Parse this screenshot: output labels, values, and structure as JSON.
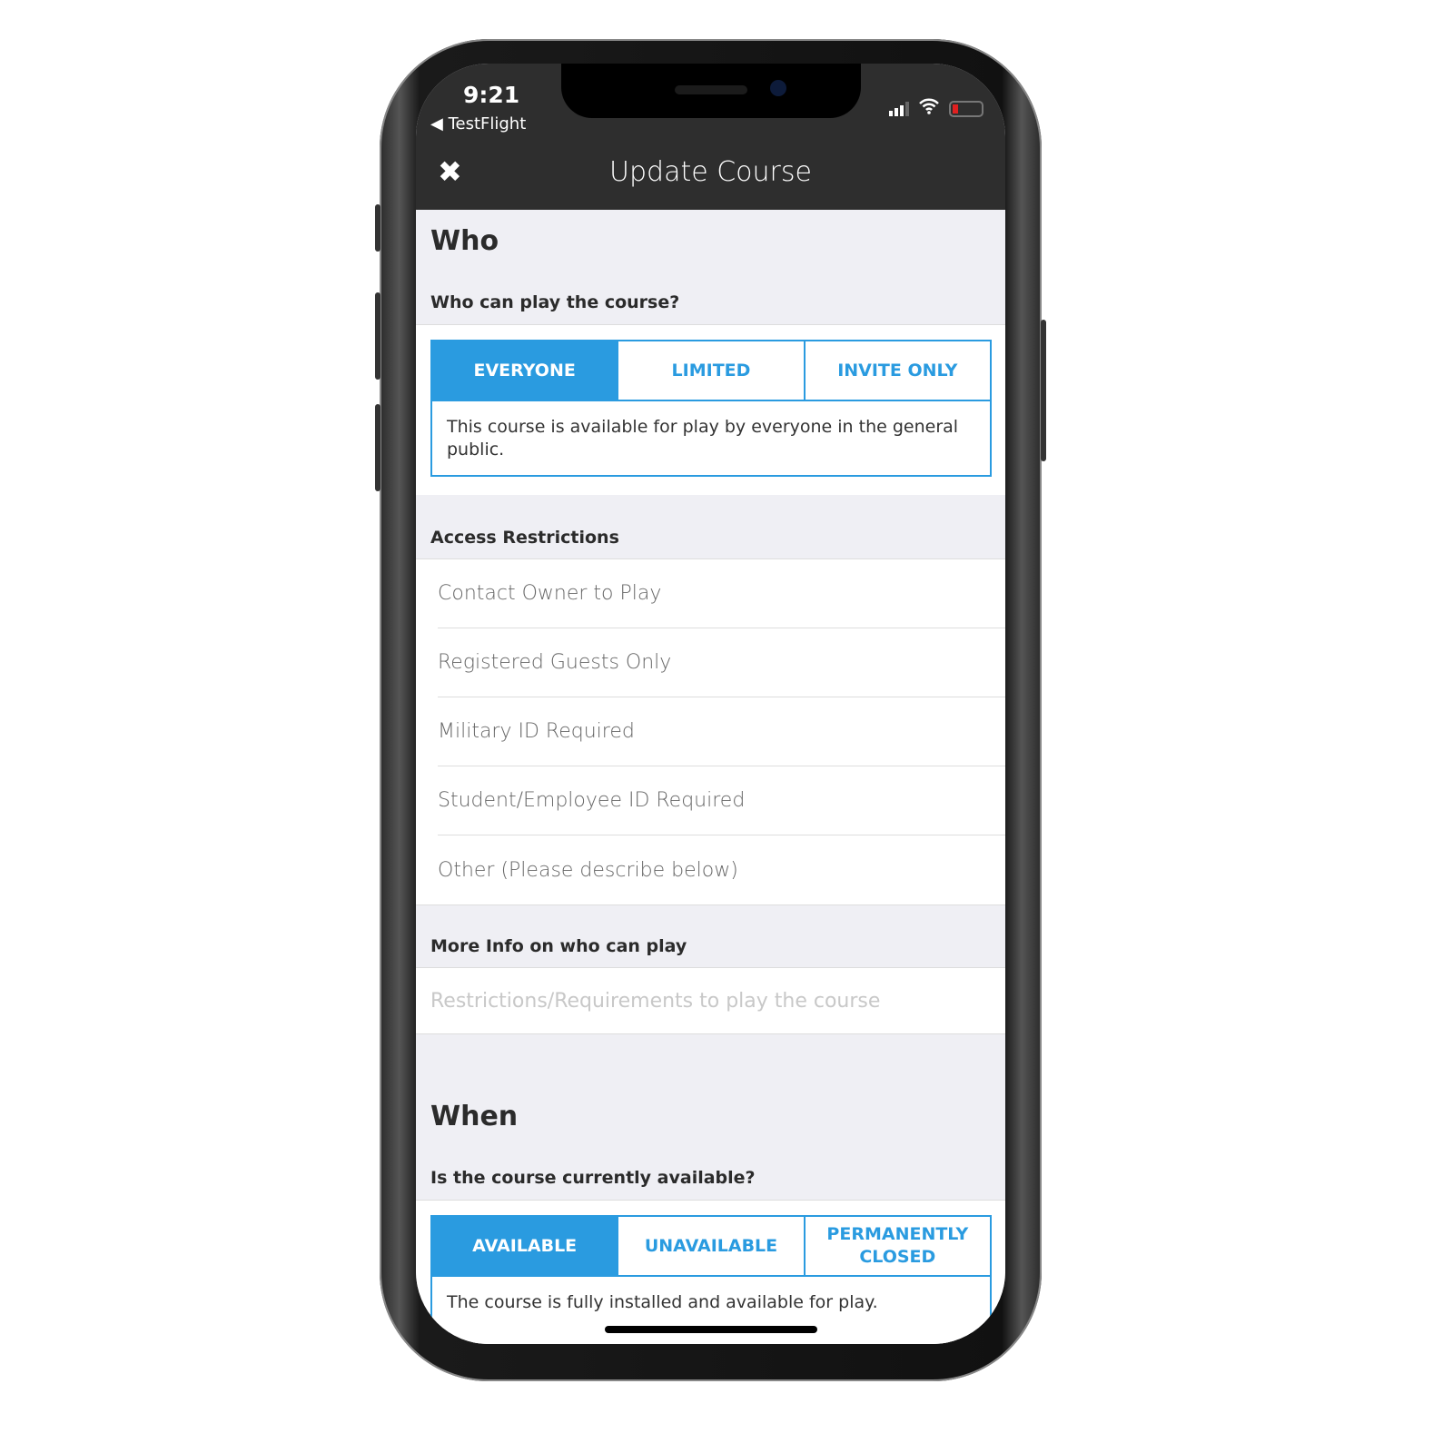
{
  "status_bar": {
    "time": "9:21",
    "back_app": "◀ TestFlight"
  },
  "header": {
    "title": "Update Course",
    "close_icon": "✖"
  },
  "who": {
    "heading": "Who",
    "question": "Who can play the course?",
    "options": [
      "EVERYONE",
      "LIMITED",
      "INVITE ONLY"
    ],
    "selected": "EVERYONE",
    "description": "This course is available for play by everyone in the general public."
  },
  "access": {
    "heading": "Access Restrictions",
    "items": [
      "Contact Owner to Play",
      "Registered Guests Only",
      "Military ID Required",
      "Student/Employee ID Required",
      "Other (Please describe below)"
    ]
  },
  "more_info": {
    "heading": "More Info on who can play",
    "placeholder": "Restrictions/Requirements to play the course"
  },
  "when": {
    "heading": "When",
    "question": "Is the course currently available?",
    "options": [
      "AVAILABLE",
      "UNAVAILABLE",
      "PERMANENTLY CLOSED"
    ],
    "selected": "AVAILABLE",
    "description": "The course is fully installed and available for play."
  },
  "colors": {
    "accent": "#2a9be0",
    "header": "#2e2e2e",
    "background": "#efeff4"
  }
}
